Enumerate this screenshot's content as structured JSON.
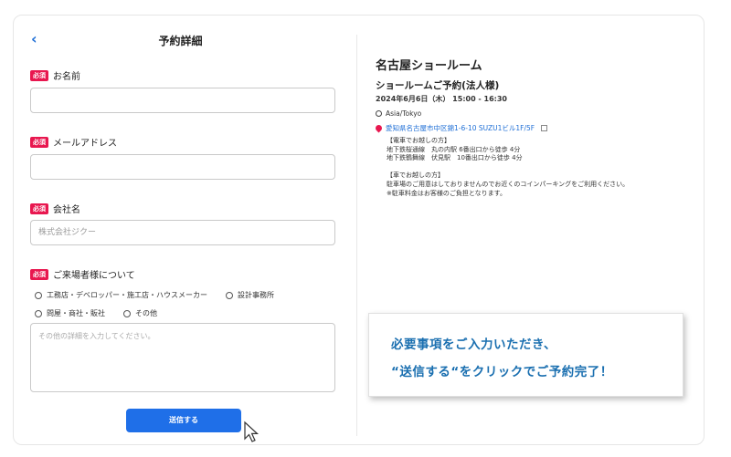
{
  "form": {
    "title": "予約詳細",
    "back_icon": "chevron-left-icon",
    "required_badge": "必須",
    "name_label": "お名前",
    "name_value": "",
    "email_label": "メールアドレス",
    "email_value": "",
    "company_label": "会社名",
    "company_placeholder": "株式会社ジクー",
    "visitor_label": "ご来場者様について",
    "options": [
      "工務店・デベロッパー・施工店・ハウスメーカー",
      "設計事務所",
      "問屋・商社・販社",
      "その他"
    ],
    "other_placeholder": "その他の詳細を入力してください。",
    "submit_label": "送信する"
  },
  "info": {
    "showroom": "名古屋ショールーム",
    "booking_type": "ショールームご予約(法人様)",
    "datetime": "2024年6月6日（木） 15:00 - 16:30",
    "timezone": "Asia/Tokyo",
    "address": "愛知県名古屋市中区錦1-6-10 SUZU1ビル1F/5F",
    "notes": "【電車でお越しの方】\n地下鉄桜通線　丸の内駅 6番出口から徒歩 4分\n地下鉄鶴舞線　伏見駅　10番出口から徒歩 4分\n\n【車でお越しの方】\n駐車場のご用意はしておりませんのでお近くのコインパーキングをご利用ください。\n※駐車料金はお客様のご負担となります。"
  },
  "callout": {
    "line1": "必要事項をご入力いただき、",
    "line2": "“送信する“をクリックでご予約完了！"
  },
  "colors": {
    "accent": "#1f6fe8",
    "required": "#e8174f",
    "callout_text": "#1a6fb0"
  }
}
